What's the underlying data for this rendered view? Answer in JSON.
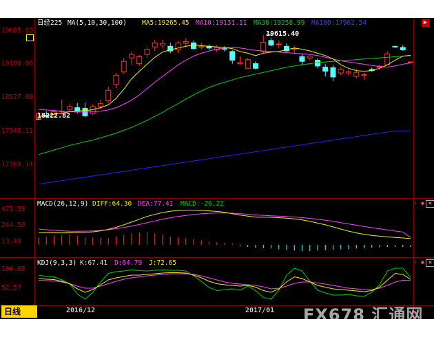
{
  "main": {
    "ticker": "日经225",
    "ma_label": "MA(5,10,30,100)",
    "ma5": "MA5:19265.45",
    "ma10": "MA10:19131.11",
    "ma30": "MA30:19258.99",
    "ma100": "MA100:17962.54",
    "hi_label": "19615.40",
    "lo_label": "18222.82",
    "y_ticks": [
      "19685.03",
      "19106.06",
      "18527.08",
      "17948.11",
      "17369.14"
    ]
  },
  "macd": {
    "label": "MACD(26,12,9)",
    "diff": "DIFF:64.30",
    "dea": "DEA:77.41",
    "macd": "MACD:-26.22",
    "y_ticks": [
      "475.59",
      "244.50",
      "13.40"
    ]
  },
  "kdj": {
    "label": "KDJ(9,3,3)",
    "k": "K:67.41",
    "d": "D:64.79",
    "j": "J:72.65",
    "y_ticks": [
      "100.08",
      "52.57"
    ]
  },
  "x_ticks": [
    "2016/12",
    "2017/01"
  ],
  "period": "日线",
  "watermark": "FX678 汇通网",
  "colors": {
    "up": "#ff3030",
    "down": "#54fcfc",
    "ma5": "#f0f000",
    "ma10": "#ff40ff",
    "ma30": "#00d000",
    "ma100": "#2020ff",
    "k": "#e0e0e0",
    "d": "#ff40ff",
    "j": "#f0f000",
    "dea": "#ff40ff",
    "diff": "#f0f000"
  },
  "chart_data": {
    "type": "candlestick",
    "y_range": [
      17369.14,
      19685.03
    ],
    "candles": [
      [
        18190,
        18260,
        18140,
        18290
      ],
      [
        18230,
        18210,
        18180,
        18300
      ],
      [
        18200,
        18290,
        18190,
        18330
      ],
      [
        18290,
        18300,
        18240,
        18500
      ],
      [
        18330,
        18380,
        18300,
        18430
      ],
      [
        18360,
        18300,
        18260,
        18440
      ],
      [
        18350,
        18220,
        18200,
        18450
      ],
      [
        18260,
        18380,
        18230,
        18420
      ],
      [
        18380,
        18430,
        18330,
        18500
      ],
      [
        18480,
        18660,
        18440,
        18720
      ],
      [
        18760,
        18920,
        18700,
        18960
      ],
      [
        18980,
        19160,
        18940,
        19220
      ],
      [
        19220,
        19280,
        19100,
        19330
      ],
      [
        19120,
        19240,
        19080,
        19270
      ],
      [
        19280,
        19370,
        19220,
        19400
      ],
      [
        19410,
        19480,
        19340,
        19530
      ],
      [
        19440,
        19470,
        19380,
        19530
      ],
      [
        19420,
        19340,
        19300,
        19480
      ],
      [
        19360,
        19480,
        19300,
        19510
      ],
      [
        19470,
        19500,
        19400,
        19560
      ],
      [
        19480,
        19380,
        19360,
        19520
      ],
      [
        19400,
        19420,
        19360,
        19480
      ],
      [
        19420,
        19390,
        19360,
        19450
      ],
      [
        19360,
        19400,
        19320,
        19440
      ],
      [
        19380,
        19370,
        19330,
        19420
      ],
      [
        19330,
        19180,
        19120,
        19350
      ],
      [
        19120,
        19140,
        19100,
        19250
      ],
      [
        19040,
        19190,
        19040,
        19220
      ],
      [
        19120,
        19040,
        19020,
        19160
      ],
      [
        19330,
        19490,
        19300,
        19615.4
      ],
      [
        19520,
        19440,
        19420,
        19560
      ],
      [
        19450,
        19460,
        19390,
        19520
      ],
      [
        19420,
        19340,
        19330,
        19470
      ],
      [
        19370,
        19380,
        19280,
        19430
      ],
      [
        19240,
        19160,
        19100,
        19280
      ],
      [
        19220,
        19250,
        19180,
        19270
      ],
      [
        19180,
        19080,
        19040,
        19210
      ],
      [
        19060,
        18990,
        18900,
        19110
      ],
      [
        19050,
        18890,
        18820,
        19100
      ],
      [
        18960,
        19020,
        18920,
        19060
      ],
      [
        18960,
        18980,
        18920,
        19020
      ],
      [
        18900,
        18970,
        18860,
        19030
      ],
      [
        18920,
        18930,
        18840,
        18960
      ],
      [
        19020,
        19000,
        18980,
        19050
      ],
      [
        19050,
        19080,
        19020,
        19100
      ],
      [
        19100,
        19290,
        19100,
        19330
      ],
      [
        19420,
        19410,
        19390,
        19430
      ],
      [
        19400,
        19360,
        19340,
        19440
      ],
      [
        19150,
        19150,
        19120,
        19160
      ]
    ],
    "ma5": [
      18210,
      18225,
      18245,
      18265,
      18290,
      18305,
      18310,
      18325,
      18360,
      18410,
      18520,
      18680,
      18860,
      18990,
      19110,
      19230,
      19320,
      19360,
      19390,
      19420,
      19440,
      19430,
      19420,
      19410,
      19400,
      19380,
      19330,
      19300,
      19260,
      19300,
      19320,
      19330,
      19360,
      19390,
      19370,
      19340,
      19300,
      19260,
      19200,
      19100,
      19040,
      19000,
      18990,
      19000,
      19040,
      19100,
      19180,
      19250,
      19265
    ],
    "ma10": [
      18330,
      18320,
      18310,
      18300,
      18290,
      18285,
      18285,
      18290,
      18300,
      18320,
      18360,
      18420,
      18490,
      18580,
      18690,
      18800,
      18900,
      19000,
      19100,
      19180,
      19250,
      19300,
      19340,
      19370,
      19390,
      19400,
      19390,
      19370,
      19350,
      19340,
      19330,
      19320,
      19310,
      19300,
      19290,
      19280,
      19260,
      19230,
      19200,
      19170,
      19150,
      19130,
      19110,
      19090,
      19070,
      19060,
      19080,
      19110,
      19131
    ],
    "ma30": [
      17550,
      17590,
      17630,
      17670,
      17710,
      17740,
      17770,
      17800,
      17840,
      17880,
      17920,
      17970,
      18020,
      18080,
      18140,
      18210,
      18280,
      18360,
      18430,
      18510,
      18580,
      18650,
      18710,
      18760,
      18800,
      18840,
      18880,
      18910,
      18940,
      18970,
      19000,
      19030,
      19060,
      19080,
      19100,
      19120,
      19140,
      19150,
      19160,
      19170,
      19180,
      19190,
      19200,
      19210,
      19220,
      19230,
      19240,
      19250,
      19259
    ],
    "ma100": [
      17040,
      17060,
      17080,
      17100,
      17120,
      17140,
      17160,
      17180,
      17200,
      17220,
      17240,
      17260,
      17280,
      17300,
      17320,
      17340,
      17360,
      17380,
      17400,
      17420,
      17440,
      17460,
      17480,
      17500,
      17520,
      17540,
      17560,
      17580,
      17600,
      17620,
      17640,
      17660,
      17680,
      17700,
      17720,
      17740,
      17760,
      17780,
      17800,
      17820,
      17840,
      17860,
      17880,
      17900,
      17920,
      17940,
      17955,
      17960,
      17962
    ],
    "macd_range": [
      13.4,
      475.59
    ],
    "diff": [
      150,
      148,
      146,
      145,
      146,
      148,
      152,
      160,
      175,
      195,
      225,
      260,
      300,
      340,
      380,
      410,
      435,
      455,
      465,
      470,
      470,
      466,
      460,
      452,
      440,
      420,
      400,
      385,
      370,
      370,
      368,
      362,
      355,
      345,
      330,
      310,
      285,
      260,
      230,
      200,
      170,
      145,
      125,
      110,
      98,
      88,
      80,
      72,
      64
    ],
    "dea": [
      200,
      190,
      182,
      175,
      170,
      168,
      170,
      174,
      180,
      190,
      205,
      222,
      242,
      265,
      290,
      315,
      340,
      362,
      380,
      395,
      408,
      418,
      425,
      428,
      428,
      426,
      420,
      412,
      402,
      396,
      390,
      384,
      378,
      371,
      363,
      353,
      340,
      326,
      310,
      292,
      273,
      255,
      237,
      220,
      204,
      188,
      172,
      158,
      77
    ],
    "macd_bar": [
      90,
      100,
      110,
      120,
      125,
      110,
      95,
      90,
      85,
      80,
      100,
      120,
      140,
      150,
      160,
      140,
      120,
      100,
      90,
      80,
      70,
      55,
      40,
      30,
      25,
      15,
      -15,
      -25,
      -35,
      -40,
      -45,
      -55,
      -65,
      -70,
      -75,
      -75,
      -70,
      -65,
      -60,
      -55,
      -50,
      -45,
      -40,
      -35,
      -30,
      -26,
      -26,
      -26,
      -26
    ],
    "kdj_range": [
      0,
      100.08
    ],
    "k": [
      70,
      68,
      67,
      62,
      55,
      40,
      30,
      38,
      52,
      66,
      72,
      76,
      80,
      80,
      82,
      84,
      86,
      87,
      87,
      86,
      80,
      72,
      62,
      55,
      52,
      50,
      48,
      50,
      45,
      35,
      30,
      40,
      60,
      75,
      70,
      60,
      50,
      45,
      40,
      38,
      36,
      34,
      32,
      35,
      45,
      65,
      85,
      82,
      67.41
    ],
    "d": [
      65,
      64,
      63,
      60,
      55,
      48,
      42,
      42,
      48,
      55,
      62,
      68,
      72,
      75,
      78,
      80,
      82,
      84,
      84,
      84,
      82,
      78,
      72,
      66,
      60,
      56,
      54,
      52,
      50,
      46,
      40,
      42,
      48,
      56,
      60,
      60,
      57,
      54,
      50,
      46,
      42,
      40,
      38,
      38,
      42,
      50,
      60,
      65,
      64.79
    ],
    "j": [
      80,
      76,
      75,
      66,
      55,
      25,
      10,
      30,
      60,
      85,
      90,
      92,
      95,
      93,
      92,
      94,
      95,
      94,
      94,
      92,
      78,
      62,
      44,
      35,
      38,
      40,
      36,
      48,
      35,
      15,
      10,
      36,
      80,
      100,
      92,
      62,
      36,
      28,
      22,
      22,
      24,
      20,
      18,
      30,
      52,
      92,
      100,
      100,
      72.65
    ]
  }
}
